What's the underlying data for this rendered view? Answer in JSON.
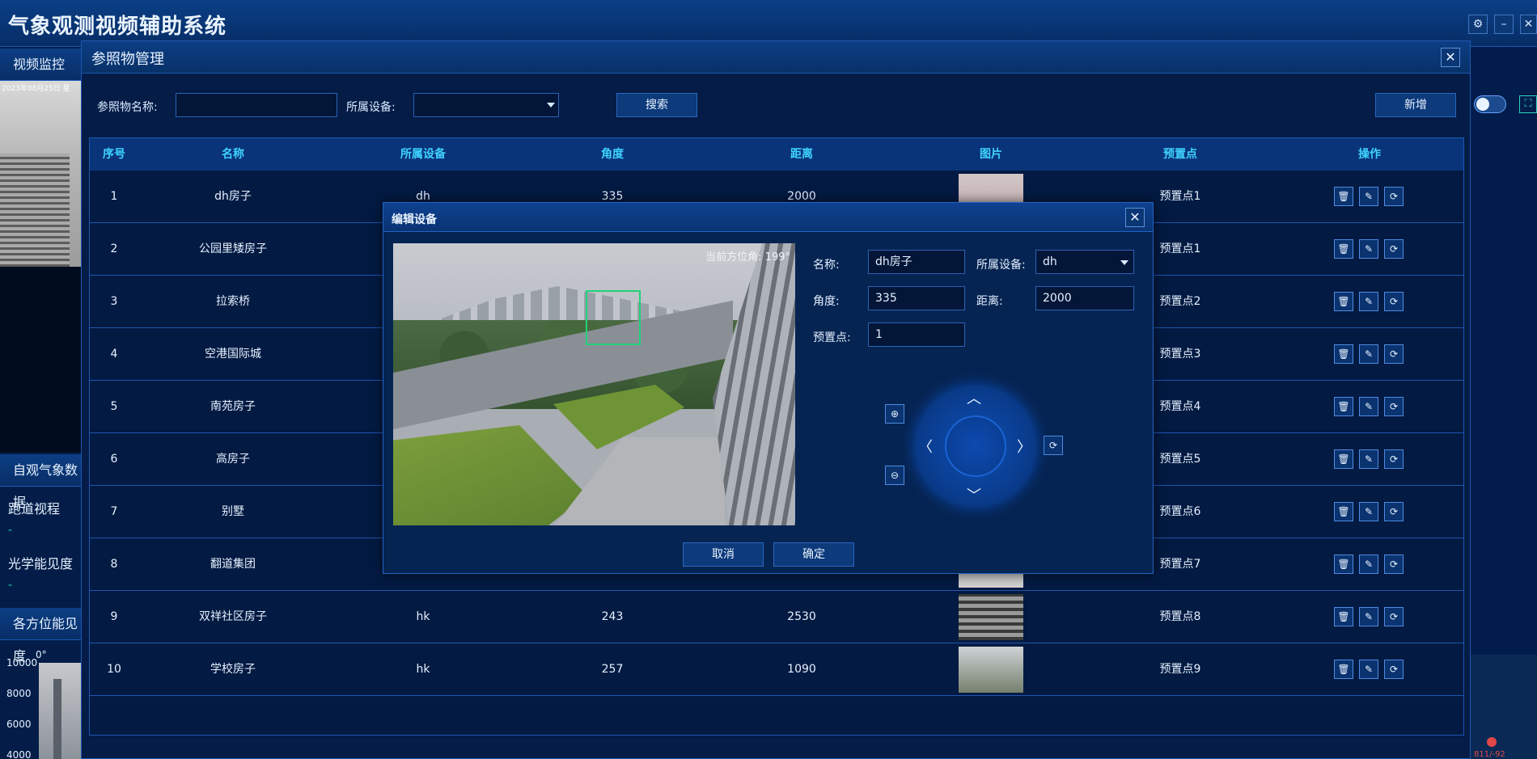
{
  "app": {
    "title": "气象观测视频辅助系统",
    "settings_icon": "⚙",
    "minimize_icon": "–",
    "close_icon": "✕"
  },
  "sidebar": {
    "video_tab": "视频监控",
    "camera_timestamp": "2023年08月25日 星",
    "weather_tab": "自观气象数据",
    "runway_label": "跑道视程",
    "runway_value": "-",
    "optical_label": "光学能见度",
    "optical_value": "-",
    "directional_tab": "各方位能见度",
    "axis_0deg": "0°",
    "axis_ticks": [
      "10000",
      "8000",
      "6000",
      "4000"
    ]
  },
  "right_panel": {
    "expand_icon": "⛶",
    "coord_text": "811/-92"
  },
  "main_dialog": {
    "title": "参照物管理",
    "close_icon": "✕",
    "filter": {
      "name_label": "参照物名称:",
      "name_value": "",
      "device_label": "所属设备:",
      "device_value": "",
      "search_button": "搜索",
      "add_button": "新增"
    },
    "table": {
      "headers": [
        "序号",
        "名称",
        "所属设备",
        "角度",
        "距离",
        "图片",
        "预置点",
        "操作"
      ],
      "rows": [
        {
          "index": "1",
          "name": "dh房子",
          "device": "dh",
          "angle": "335",
          "distance": "2000",
          "preset": "预置点1"
        },
        {
          "index": "2",
          "name": "公园里矮房子",
          "device": "",
          "angle": "",
          "distance": "",
          "preset": "预置点1"
        },
        {
          "index": "3",
          "name": "拉索桥",
          "device": "",
          "angle": "",
          "distance": "",
          "preset": "预置点2"
        },
        {
          "index": "4",
          "name": "空港国际城",
          "device": "",
          "angle": "",
          "distance": "",
          "preset": "预置点3"
        },
        {
          "index": "5",
          "name": "南苑房子",
          "device": "",
          "angle": "",
          "distance": "",
          "preset": "预置点4"
        },
        {
          "index": "6",
          "name": "高房子",
          "device": "",
          "angle": "",
          "distance": "",
          "preset": "预置点5"
        },
        {
          "index": "7",
          "name": "别墅",
          "device": "",
          "angle": "",
          "distance": "",
          "preset": "预置点6"
        },
        {
          "index": "8",
          "name": "翻道集团",
          "device": "",
          "angle": "",
          "distance": "",
          "preset": "预置点7"
        },
        {
          "index": "9",
          "name": "双祥社区房子",
          "device": "hk",
          "angle": "243",
          "distance": "2530",
          "preset": "预置点8"
        },
        {
          "index": "10",
          "name": "学校房子",
          "device": "hk",
          "angle": "257",
          "distance": "1090",
          "preset": "预置点9"
        }
      ],
      "op_icons": {
        "delete": "🗑",
        "edit": "✎",
        "refresh": "⟳"
      }
    }
  },
  "edit_dialog": {
    "title": "编辑设备",
    "close_icon": "✕",
    "azimuth_text": "当前方位角: 199°",
    "name_label": "名称:",
    "name_value": "dh房子",
    "device_label": "所属设备:",
    "device_value": "dh",
    "angle_label": "角度:",
    "angle_value": "335",
    "distance_label": "距离:",
    "distance_value": "2000",
    "preset_label": "预置点:",
    "preset_value": "1",
    "ptz": {
      "up": "︿",
      "down": "﹀",
      "left": "〈",
      "right": "〉",
      "zoom_in": "⊕",
      "zoom_out": "⊖",
      "reset": "⟳"
    },
    "cancel_button": "取消",
    "confirm_button": "确定"
  },
  "colors": {
    "accent": "#3fd3ff",
    "panel": "#041c46",
    "border": "#1d57b0",
    "green_marker": "#20d27a"
  }
}
